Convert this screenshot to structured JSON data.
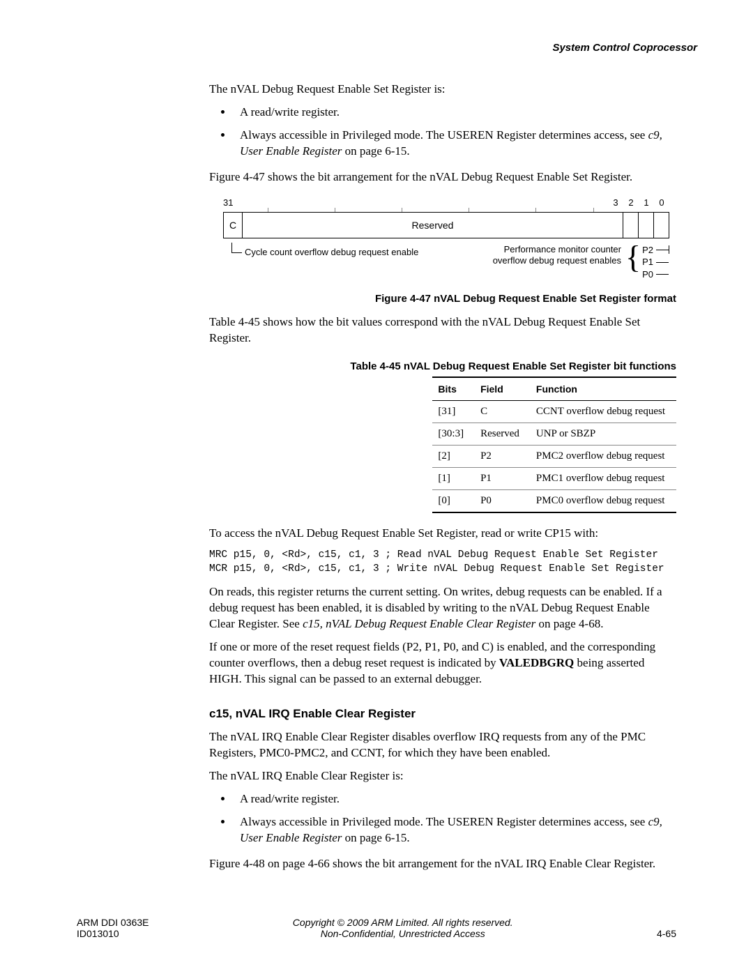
{
  "header": {
    "section": "System Control Coprocessor"
  },
  "p_intro": "The nVAL Debug Request Enable Set Register is:",
  "bullets1": {
    "a": "A read/write register.",
    "b_prefix": "Always accessible in Privileged mode. The USEREN Register determines access, see ",
    "b_link": "c9, User Enable Register",
    "b_suffix": " on page 6-15."
  },
  "p_fig": "Figure 4-47 shows the bit arrangement for the nVAL Debug Request Enable Set Register.",
  "fig": {
    "bit31": "31",
    "bit3": "3",
    "bit2": "2",
    "bit1": "1",
    "bit0": "0",
    "cell_c": "C",
    "cell_reserved": "Reserved",
    "left_label": "Cycle count overflow debug  request enable",
    "right_label_l1": "Performance monitor counter",
    "right_label_l2": "overflow debug request enables",
    "p2": "P2",
    "p1": "P1",
    "p0": "P0",
    "caption": "Figure 4-47 nVAL Debug Request Enable Set Register format"
  },
  "p_tbl": "Table 4-45 shows how the bit values correspond with the nVAL Debug Request Enable Set Register.",
  "tbl": {
    "caption": "Table 4-45 nVAL Debug Request Enable Set Register bit functions",
    "h1": "Bits",
    "h2": "Field",
    "h3": "Function",
    "rows": [
      {
        "bits": "[31]",
        "field": "C",
        "func": "CCNT overflow debug request"
      },
      {
        "bits": "[30:3]",
        "field": "Reserved",
        "func": "UNP or SBZP"
      },
      {
        "bits": "[2]",
        "field": "P2",
        "func": "PMC2 overflow debug request"
      },
      {
        "bits": "[1]",
        "field": "P1",
        "func": "PMC1 overflow debug request"
      },
      {
        "bits": "[0]",
        "field": "P0",
        "func": "PMC0 overflow debug request"
      }
    ]
  },
  "p_access": "To access the nVAL Debug Request Enable Set Register, read or write CP15 with:",
  "code": "MRC p15, 0, <Rd>, c15, c1, 3 ; Read nVAL Debug Request Enable Set Register\nMCR p15, 0, <Rd>, c15, c1, 3 ; Write nVAL Debug Request Enable Set Register",
  "p_reads_a": "On reads, this register returns the current setting. On writes, debug requests can be enabled. If a debug request has been enabled, it is disabled by writing to the nVAL Debug Request Enable Clear Register. See ",
  "p_reads_link": "c15, nVAL Debug Request Enable Clear Register",
  "p_reads_b": " on page 4-68.",
  "p_reset_a": "If one or more of the reset request fields (P2, P1, P0, and C) is enabled, and the corresponding counter overflows, then a debug reset request is indicated by ",
  "p_reset_bold": "VALEDBGRQ",
  "p_reset_b": " being asserted HIGH. This signal can be passed to an external debugger.",
  "sec_title": "c15, nVAL IRQ Enable Clear Register",
  "p_irq1": "The nVAL IRQ Enable Clear Register disables overflow IRQ requests from any of the PMC Registers, PMC0-PMC2, and CCNT, for which they have been enabled.",
  "p_irq2": "The nVAL IRQ Enable Clear Register is:",
  "bullets2": {
    "a": "A read/write register.",
    "b_prefix": "Always accessible in Privileged mode. The USEREN Register determines access, see ",
    "b_link": "c9, User Enable Register",
    "b_suffix": " on page 6-15."
  },
  "p_fig48": "Figure 4-48 on page 4-66 shows the bit arrangement for the nVAL IRQ Enable Clear Register.",
  "footer": {
    "doc": "ARM DDI 0363E",
    "id": "ID013010",
    "copy": "Copyright © 2009 ARM Limited. All rights reserved.",
    "conf": "Non-Confidential, Unrestricted Access",
    "page": "4-65"
  }
}
